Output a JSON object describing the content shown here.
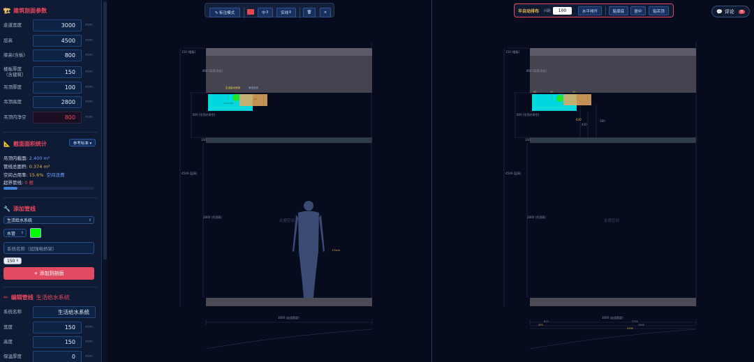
{
  "sidebar": {
    "building": {
      "title": "建筑剖面参数",
      "params": [
        {
          "label": "走道宽度",
          "value": "3000",
          "unit": "mm"
        },
        {
          "label": "层高",
          "value": "4500",
          "unit": "mm"
        },
        {
          "label": "梁高(含板)",
          "value": "800",
          "unit": "mm"
        },
        {
          "label": "楼板厚度\n（含建筑）",
          "value": "150",
          "unit": "mm"
        },
        {
          "label": "吊顶厚度",
          "value": "100",
          "unit": "mm"
        },
        {
          "label": "吊顶高度",
          "value": "2800",
          "unit": "mm"
        },
        {
          "label": "吊顶内净空",
          "value": "800",
          "unit": "mm"
        }
      ]
    },
    "stats": {
      "title": "截面面积统计",
      "ref_button": "参考标准 ▾",
      "ceiling_area_label": "吊顶内截面:",
      "ceiling_area_value": "2.400 m²",
      "pipe_area_label": "管线总面积:",
      "pipe_area_value": "0.374 m²",
      "usage_label": "空间占用率:",
      "usage_value": "15.6%",
      "usage_note": "空间浪费",
      "usage_fraction": 0.156,
      "overflow_label": "超界管线:",
      "overflow_value": "0 根"
    },
    "add_pipe": {
      "title": "添加管线",
      "system_select": "生活给水系统",
      "type_select": "水管",
      "color": "#00ff00",
      "name_placeholder": "系统名称（如强电桥架）",
      "size_select": "150",
      "add_button": "+ 添加到剖面"
    },
    "edit_pipe": {
      "title": "编辑管线",
      "title_target": "生活给水系统",
      "fields": [
        {
          "label": "系统名称",
          "value": "生活给水系统"
        },
        {
          "label": "宽度",
          "value": "150",
          "unit": "mm"
        },
        {
          "label": "高度",
          "value": "150",
          "unit": "mm"
        },
        {
          "label": "保温厚度",
          "value": "0",
          "unit": "mm"
        }
      ]
    }
  },
  "toolbar_left": {
    "annotate": "✎ 标注模式",
    "color": "#e24a5a",
    "weight_select": "中",
    "style_select": "实线",
    "trash_icon": "🗑",
    "close": "×"
  },
  "toolbar_right": {
    "title": "半自动排布",
    "spacing_label": "间距",
    "spacing_value": "100",
    "buttons": [
      "水平排开",
      "贴梁底",
      "居中",
      "贴吊顶"
    ]
  },
  "comment": {
    "label": "评论",
    "count": "0"
  },
  "section_left": {
    "slab_label": "150 (楼板)",
    "beam_label": "800 (梁高/含板)",
    "clear_label": "800 (吊顶内净空)",
    "ceiling_thk": "100",
    "floor_height": "4500 (层高)",
    "ceiling_height": "2800 (吊顶高)",
    "space_label": "走廊空间",
    "person_height": "170cm",
    "width_label": "3000 (走道宽度)",
    "pipe_label_1": "生活给水系统",
    "pipe_label_2": "管线系统",
    "pipe_small": "400×150",
    "pipe_small_2": "400"
  },
  "section_right": {
    "slab_label": "150 (楼板)",
    "beam_label": "800 (梁高/含板)",
    "clear_label": "800 (吊顶内净空)",
    "ceiling_thk": "100",
    "floor_height": "4500 (层高)",
    "ceiling_height": "2800 (吊顶高)",
    "space_label": "走廊空间",
    "width_label": "3000 (走道宽度)",
    "dim_630": "630",
    "dim_440": "440",
    "dim_580": "580",
    "dim_50": "50",
    "dim_30": "30",
    "dim_20": "20",
    "dim_610": "610",
    "dim_2320": "2320",
    "dim_470": "470",
    "dim_1900": "1900",
    "dim_2390": "2390"
  }
}
